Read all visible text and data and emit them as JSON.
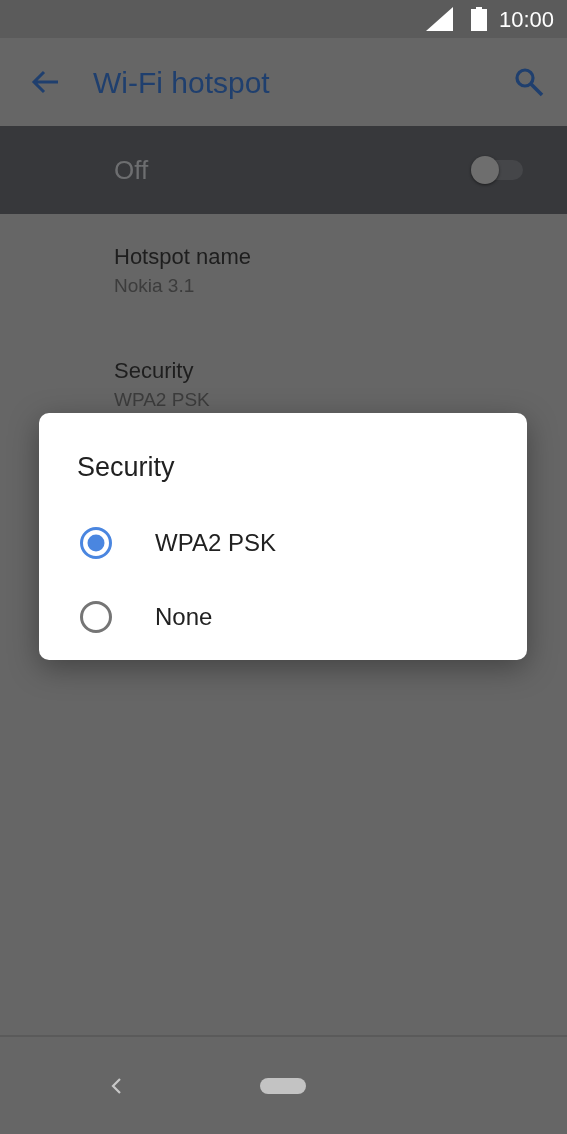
{
  "status_bar": {
    "time": "10:00"
  },
  "app_bar": {
    "title": "Wi-Fi hotspot"
  },
  "main_switch": {
    "label": "Off",
    "on": false
  },
  "settings": [
    {
      "title": "Hotspot name",
      "summary": "Nokia 3.1"
    },
    {
      "title": "Security",
      "summary": "WPA2 PSK"
    }
  ],
  "dialog": {
    "title": "Security",
    "options": [
      {
        "label": "WPA2 PSK",
        "selected": true
      },
      {
        "label": "None",
        "selected": false
      }
    ]
  }
}
